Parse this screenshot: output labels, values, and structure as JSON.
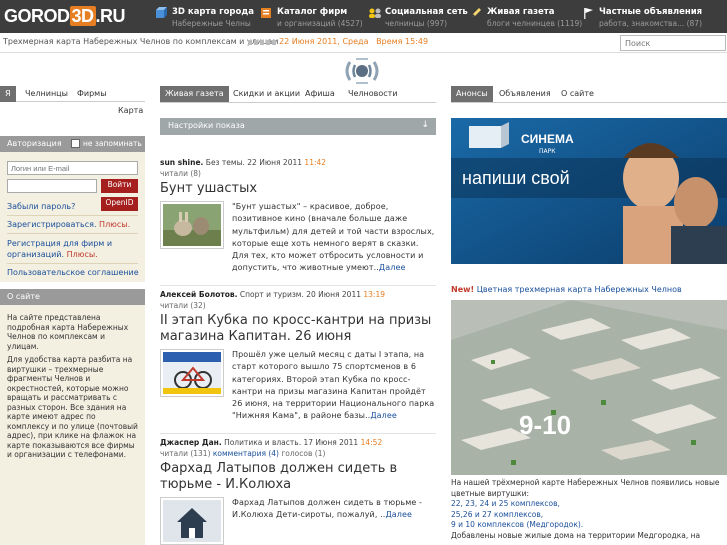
{
  "header": {
    "logo": {
      "part1": "GOROD",
      "part2": "3D",
      "part3": ".RU"
    },
    "nav": [
      {
        "title": "3D карта города",
        "sub": "Набережные Челны",
        "icon": "cube-icon"
      },
      {
        "title": "Каталог фирм",
        "sub": "и организаций (4527)",
        "icon": "catalog-icon"
      },
      {
        "title": "Социальная сеть",
        "sub": "челнинцы (997)",
        "icon": "people-icon"
      },
      {
        "title": "Живая газета",
        "sub": "блоги челнинцев (1119)",
        "icon": "pencil-icon"
      },
      {
        "title": "Частные объявления",
        "sub": "работа, знакомства... (87)",
        "icon": "flag-icon"
      }
    ],
    "description": "Трехмерная карта Набережных Челнов по комплексам и улицам",
    "date": "22 Июня 2011, Среда",
    "time": "Время 15:49",
    "search_placeholder": "Поиск"
  },
  "left": {
    "tabs": [
      "Я",
      "Челнинцы",
      "Фирмы"
    ],
    "map_link": "Карта",
    "auth": {
      "title": "Авторизация",
      "remember": "не запоминать",
      "login_placeholder": "Логин или E-mail",
      "enter_button": "Войти",
      "forgot": "Забыли пароль?",
      "openid": "OpenID",
      "register": "Зарегистрироваться.",
      "register_plus": "Плюсы.",
      "register_firms": "Регистрация для фирм и организаций.",
      "register_firms_plus": "Плюсы.",
      "agreement": "Пользовательское соглашение"
    },
    "about": {
      "title": "О сайте",
      "p1": "На сайте представлена подробная карта Набережных Челнов по комплексам и улицам.",
      "p2": "Для удобства карта разбита на виртушки – трехмерные фрагменты Челнов и окрестностей, которые можно вращать и рассматривать с разных сторон. Все здания на карте имеют адрес по комплексу и по улице (почтовый адрес), при клике на флажок на карте показываются все фирмы и организации с телефонами."
    }
  },
  "center": {
    "tabs": [
      "Живая газета",
      "Скидки и акции",
      "Афиша",
      "Челновости"
    ],
    "settings": "Настройки показа",
    "posts": [
      {
        "author": "sun shine.",
        "category": "Без темы.",
        "date": "22 Июня 2011",
        "time": "11:42",
        "reads": "читали (8)",
        "comments": "",
        "votes": "",
        "title": "Бунт ушастых",
        "text": "\"Бунт ушастых\" – красивое, доброе, позитивное кино (вначале больше даже мультфильм) для детей и той части взрослых, которые еще хоть немного верят в сказки. Для тех, кто может отбросить условности и допустить, что животные умеют..",
        "more": "Далее"
      },
      {
        "author": "Алексей Болотов.",
        "category": "Спорт и туризм.",
        "date": "20 Июня 2011",
        "time": "13:19",
        "reads": "читали (32)",
        "comments": "",
        "votes": "",
        "title": "II этап Кубка по кросс-кантри на призы магазина Капитан. 26 июня",
        "text": "Прошёл уже целый месяц с даты I этапа, на старт которого вышло 75 спортсменов в 6 категориях. Второй этап Кубка по кросс-кантри на призы магазина Капитан пройдёт 26 июня, на территории Национального парка \"Нижняя Кама\", в районе базы..",
        "more": "Далее"
      },
      {
        "author": "Джаспер Дан.",
        "category": "Политика и власть.",
        "date": "17 Июня 2011",
        "time": "14:52",
        "reads": "читали (131)",
        "comments": "комментария (4)",
        "votes": "голосов (1)",
        "title": "Фархад Латыпов должен сидеть в тюрьме - И.Колюха",
        "text": "Фархад Латыпов должен сидеть в тюрьме - И.Колюха Дети-сироты, пожалуй, ..",
        "more": "Далее"
      }
    ]
  },
  "right": {
    "tabs": [
      "Анонсы",
      "Объявления",
      "О сайте"
    ],
    "banner": {
      "brand": "СИНЕМА",
      "brand_sub": "ПАРК",
      "slogan": "напиши свой"
    },
    "new_label": "New!",
    "new_text": "Цветная трехмерная карта Набережных Челнов",
    "map_label": "9-10",
    "news_intro": "На нашей трёхмерной карте Набережных Челнов появились новые цветные виртушки:",
    "news_lines": [
      "22, 23, 24 и 25 комплексов,",
      "25,26 и 27 комплексов,",
      "9 и 10 комплексов (Медгородок).",
      "Добавлены новые жилые дома на территории Медгородка, на"
    ]
  },
  "colors": {
    "accent": "#e67e22",
    "topbar": "#3d3d3d",
    "link": "#1a4f9a",
    "red": "#a51f1f"
  }
}
